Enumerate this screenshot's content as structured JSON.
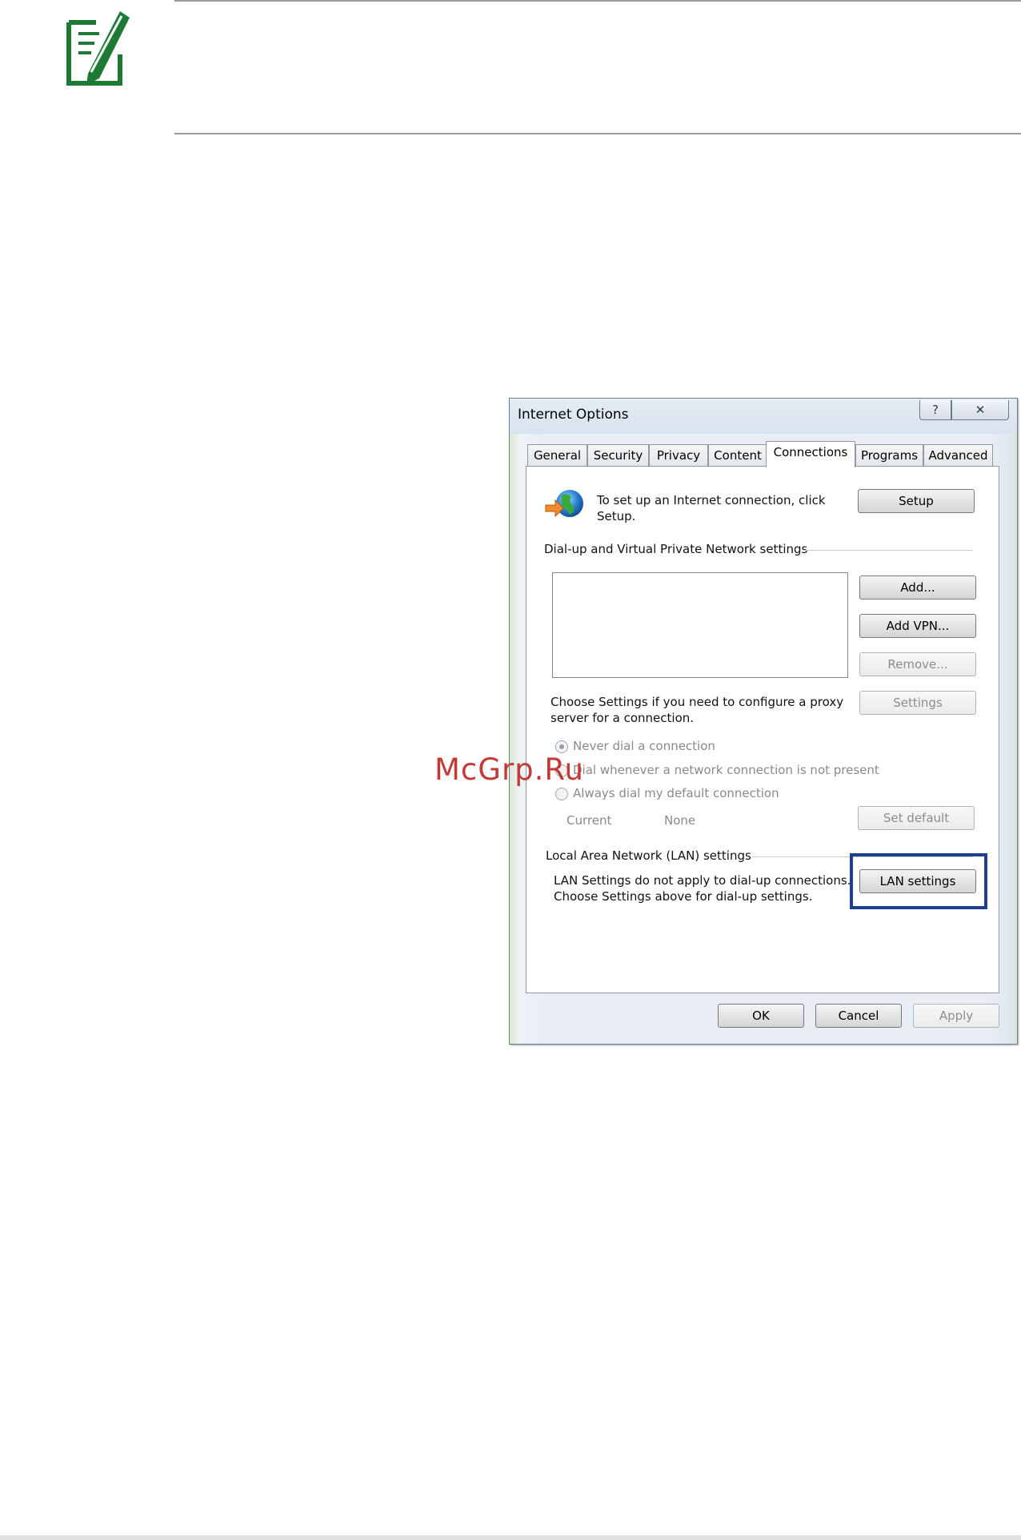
{
  "dialog": {
    "title": "Internet Options",
    "help_glyph": "?",
    "close_glyph": "✕",
    "tabs": [
      {
        "label": "General"
      },
      {
        "label": "Security"
      },
      {
        "label": "Privacy"
      },
      {
        "label": "Content"
      },
      {
        "label": "Connections"
      },
      {
        "label": "Programs"
      },
      {
        "label": "Advanced"
      }
    ],
    "setup_text_line1": "To set up an Internet connection, click",
    "setup_text_line2": "Setup.",
    "setup_button": "Setup",
    "dialup_heading": "Dial-up and Virtual Private Network settings",
    "add_button": "Add...",
    "add_vpn_button": "Add VPN...",
    "remove_button": "Remove...",
    "proxy_text_line1": "Choose Settings if you need to configure a proxy",
    "proxy_text_line2": "server for a connection.",
    "settings_button": "Settings",
    "radio_never": "Never dial a connection",
    "radio_whenever": "Dial whenever a network connection is not present",
    "radio_always": "Always dial my default connection",
    "current_label": "Current",
    "current_value": "None",
    "set_default_button": "Set default",
    "lan_heading": "Local Area Network (LAN) settings",
    "lan_text_line1": "LAN Settings do not apply to dial-up connections.",
    "lan_text_line2": "Choose Settings above for dial-up settings.",
    "lan_settings_button": "LAN settings",
    "ok_button": "OK",
    "cancel_button": "Cancel",
    "apply_button": "Apply"
  },
  "watermark": "McGrp.Ru",
  "colors": {
    "note_icon": "#1d7a35",
    "highlight_box": "#1f3f8f",
    "watermark": "#c23a36"
  }
}
